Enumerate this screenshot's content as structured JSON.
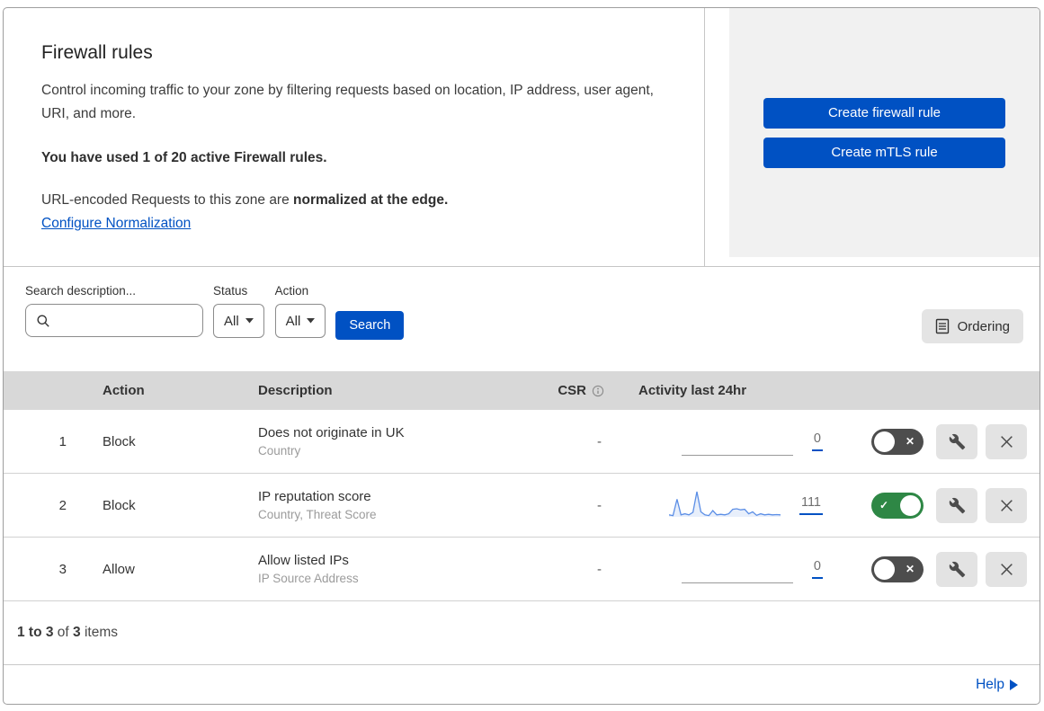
{
  "header": {
    "title": "Firewall rules",
    "description": "Control incoming traffic to your zone by filtering requests based on location, IP address, user agent, URI, and more.",
    "usage": "You have used 1 of 20 active Firewall rules.",
    "normalization_prefix": "URL-encoded Requests to this zone are ",
    "normalization_bold": "normalized at the edge.",
    "normalization_link": "Configure Normalization",
    "create_firewall_button": "Create firewall rule",
    "create_mtls_button": "Create mTLS rule"
  },
  "filters": {
    "search_label": "Search description...",
    "status_label": "Status",
    "status_value": "All",
    "action_label": "Action",
    "action_value": "All",
    "search_button": "Search",
    "ordering_button": "Ordering"
  },
  "table": {
    "columns": {
      "action": "Action",
      "description": "Description",
      "csr": "CSR",
      "activity": "Activity last 24hr"
    },
    "rows": [
      {
        "num": "1",
        "action": "Block",
        "description": "Does not originate in UK",
        "fields": "Country",
        "csr": "-",
        "count": "0",
        "enabled": false
      },
      {
        "num": "2",
        "action": "Block",
        "description": "IP reputation score",
        "fields": "Country, Threat Score",
        "csr": "-",
        "count": "111",
        "enabled": true,
        "sparkline": [
          8,
          5,
          70,
          8,
          12,
          8,
          18,
          100,
          20,
          8,
          5,
          25,
          8,
          10,
          8,
          12,
          30,
          32,
          28,
          30,
          12,
          20,
          6,
          12,
          8,
          10,
          8,
          9,
          8
        ]
      },
      {
        "num": "3",
        "action": "Allow",
        "description": "Allow listed IPs",
        "fields": "IP Source Address",
        "csr": "-",
        "count": "0",
        "enabled": false
      }
    ]
  },
  "footer": {
    "range": "1 to 3",
    "of": "of",
    "total": "3",
    "items": "items",
    "help": "Help"
  },
  "toggle_glyphs": {
    "off": "✕",
    "on": "✓"
  },
  "colors": {
    "accent": "#0051c3",
    "toggle_on": "#2e8745",
    "toggle_off": "#4d4d4d",
    "sparkline": "#5b8ee6"
  }
}
